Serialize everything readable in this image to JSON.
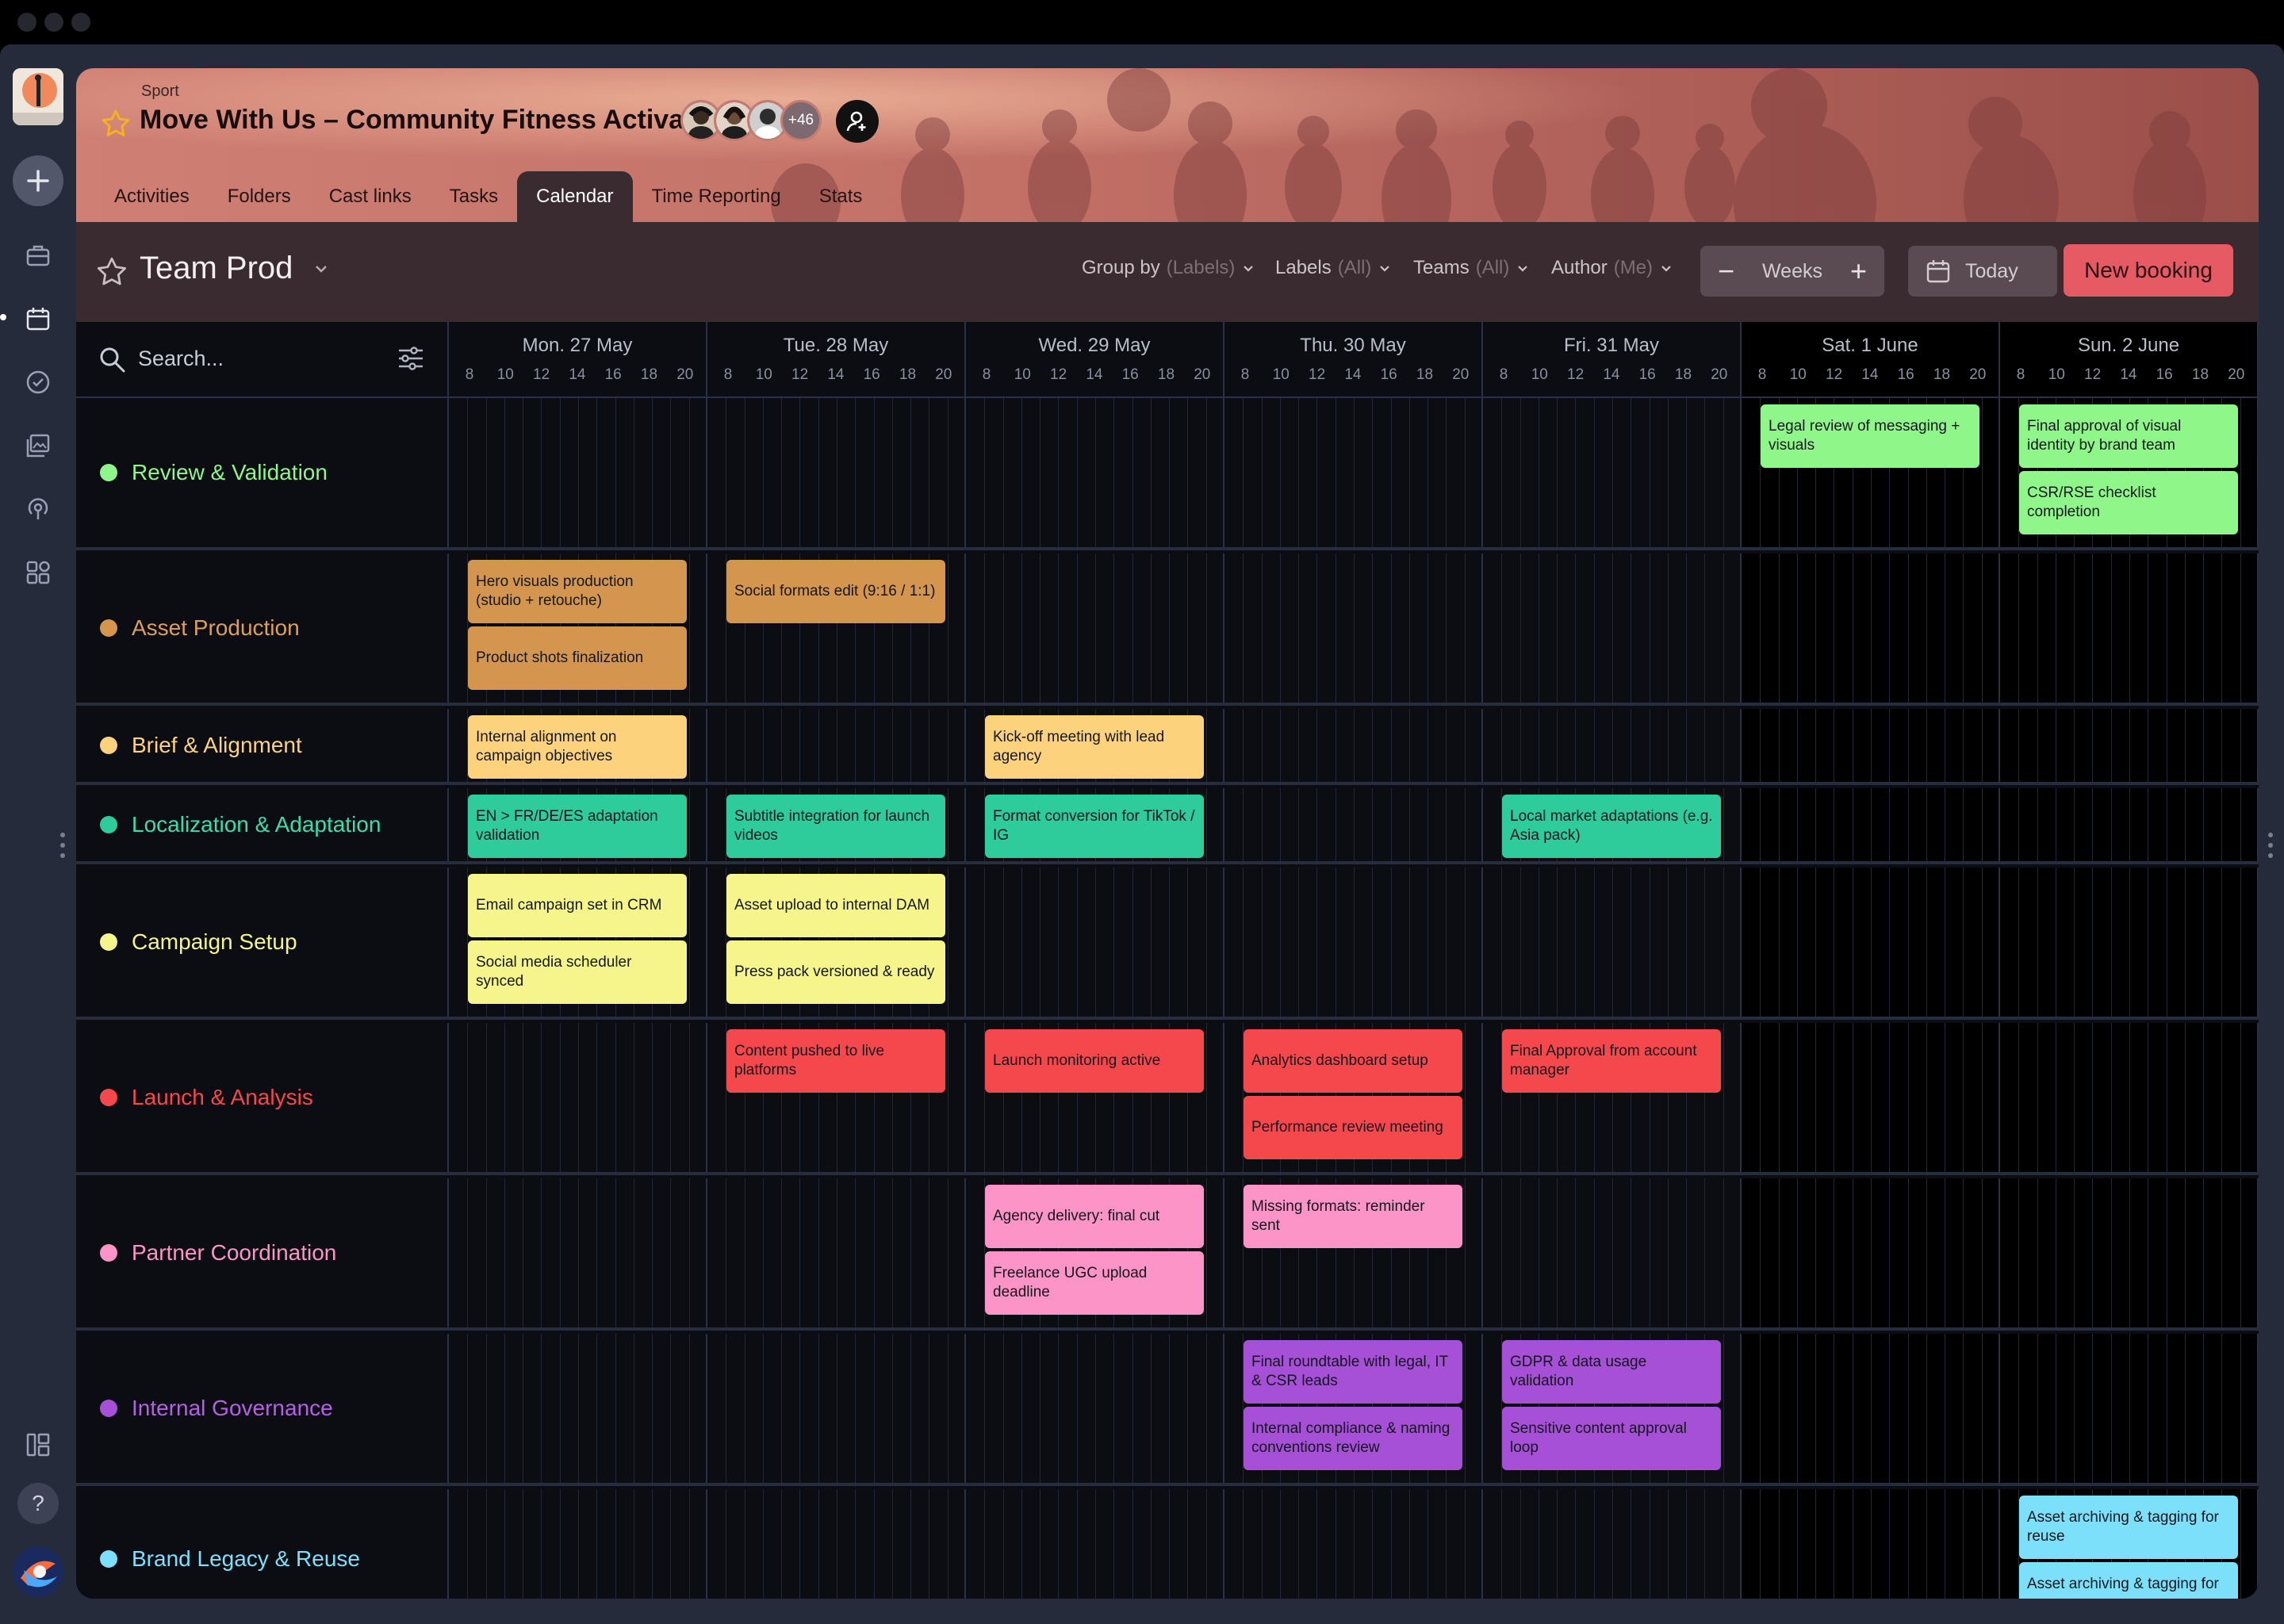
{
  "window": {
    "title": "Move With Us – Community Fitness Activation"
  },
  "project": {
    "crumb": "Sport",
    "title": "Move With Us – Community Fitness Activation",
    "avatars_more": "+46"
  },
  "tabs": [
    "Activities",
    "Folders",
    "Cast links",
    "Tasks",
    "Calendar",
    "Time Reporting",
    "Stats"
  ],
  "active_tab": "Calendar",
  "toolbar": {
    "team": "Team Prod",
    "filters": [
      {
        "label": "Group by",
        "value": "(Labels)"
      },
      {
        "label": "Labels",
        "value": "(All)"
      },
      {
        "label": "Teams",
        "value": "(All)"
      },
      {
        "label": "Author",
        "value": "(Me)"
      }
    ],
    "minus": "−",
    "weeks": "Weeks",
    "plus": "+",
    "today": "Today",
    "new_booking": "New booking"
  },
  "search": {
    "placeholder": "Search..."
  },
  "days": [
    {
      "label": "Mon. 27 May",
      "weekend": false
    },
    {
      "label": "Tue. 28 May",
      "weekend": false
    },
    {
      "label": "Wed. 29 May",
      "weekend": false
    },
    {
      "label": "Thu. 30 May",
      "weekend": false
    },
    {
      "label": "Fri. 31 May",
      "weekend": false
    },
    {
      "label": "Sat. 1 June",
      "weekend": true
    },
    {
      "label": "Sun. 2 June",
      "weekend": true
    }
  ],
  "hours": [
    "8",
    "10",
    "12",
    "14",
    "16",
    "18",
    "20"
  ],
  "colors": {
    "review": "#8ff78a",
    "asset": "#d4964f",
    "brief": "#fdd27d",
    "localization": "#2ecc9a",
    "campaign": "#f6f58c",
    "launch": "#f5484d",
    "partner": "#fc94c8",
    "governance": "#a64fd7",
    "brand": "#7de0fa"
  },
  "rows": [
    {
      "label": "Review & Validation",
      "color": "#8ff78a",
      "text_color": "#8ff78a",
      "events": [
        {
          "day": 5,
          "slot": 0,
          "text": "Legal review of messaging + visuals"
        },
        {
          "day": 6,
          "slot": 0,
          "text": "Final approval of visual identity by brand team"
        },
        {
          "day": 6,
          "slot": 1,
          "text": "CSR/RSE checklist completion"
        }
      ]
    },
    {
      "label": "Asset Production",
      "color": "#d4964f",
      "text_color": "#dca05a",
      "events": [
        {
          "day": 0,
          "slot": 0,
          "text": "Hero visuals production (studio + retouche)"
        },
        {
          "day": 0,
          "slot": 1,
          "text": "Product shots finalization"
        },
        {
          "day": 1,
          "slot": 0,
          "text": "Social formats edit (9:16 / 1:1)"
        }
      ]
    },
    {
      "label": "Brief & Alignment",
      "color": "#fdd27d",
      "text_color": "#fdd27d",
      "events": [
        {
          "day": 0,
          "slot": 0,
          "text": "Internal alignment on campaign objectives"
        },
        {
          "day": 2,
          "slot": 0,
          "text": "Kick-off meeting with lead agency"
        }
      ]
    },
    {
      "label": "Localization & Adaptation",
      "color": "#2ecc9a",
      "text_color": "#3ddcaa",
      "events": [
        {
          "day": 0,
          "slot": 0,
          "text": "EN > FR/DE/ES adaptation validation"
        },
        {
          "day": 1,
          "slot": 0,
          "text": "Subtitle integration for launch videos"
        },
        {
          "day": 2,
          "slot": 0,
          "text": "Format conversion for TikTok / IG"
        },
        {
          "day": 4,
          "slot": 0,
          "text": "Local market adaptations (e.g. Asia pack)"
        }
      ]
    },
    {
      "label": "Campaign Setup",
      "color": "#f6f58c",
      "text_color": "#f6f58c",
      "events": [
        {
          "day": 0,
          "slot": 0,
          "text": "Email campaign set in CRM"
        },
        {
          "day": 0,
          "slot": 1,
          "text": "Social media scheduler synced"
        },
        {
          "day": 1,
          "slot": 0,
          "text": "Asset upload to internal DAM"
        },
        {
          "day": 1,
          "slot": 1,
          "text": "Press pack versioned & ready"
        }
      ]
    },
    {
      "label": "Launch & Analysis",
      "color": "#f5484d",
      "text_color": "#f5484d",
      "events": [
        {
          "day": 1,
          "slot": 0,
          "text": "Content pushed to live platforms"
        },
        {
          "day": 2,
          "slot": 0,
          "text": "Launch monitoring active"
        },
        {
          "day": 3,
          "slot": 0,
          "text": "Analytics dashboard setup"
        },
        {
          "day": 3,
          "slot": 1,
          "text": "Performance review meeting"
        },
        {
          "day": 4,
          "slot": 0,
          "text": "Final Approval from account manager"
        }
      ]
    },
    {
      "label": "Partner Coordination",
      "color": "#fc94c8",
      "text_color": "#fc94c8",
      "events": [
        {
          "day": 2,
          "slot": 0,
          "text": "Agency delivery: final cut"
        },
        {
          "day": 2,
          "slot": 1,
          "text": "Freelance UGC upload deadline"
        },
        {
          "day": 3,
          "slot": 0,
          "text": "Missing formats: reminder sent"
        }
      ]
    },
    {
      "label": "Internal Governance",
      "color": "#a64fd7",
      "text_color": "#b561e6",
      "events": [
        {
          "day": 3,
          "slot": 0,
          "text": "Final roundtable with legal, IT & CSR leads"
        },
        {
          "day": 3,
          "slot": 1,
          "text": "Internal compliance & naming conventions review"
        },
        {
          "day": 4,
          "slot": 0,
          "text": "GDPR & data usage validation"
        },
        {
          "day": 4,
          "slot": 1,
          "text": "Sensitive content approval loop"
        }
      ]
    },
    {
      "label": "Brand Legacy & Reuse",
      "color": "#7de0fa",
      "text_color": "#7de0fa",
      "events": [
        {
          "day": 6,
          "slot": 0,
          "text": "Asset archiving & tagging for reuse"
        },
        {
          "day": 6,
          "slot": 1,
          "text": "Asset archiving & tagging for reuse"
        }
      ]
    }
  ]
}
